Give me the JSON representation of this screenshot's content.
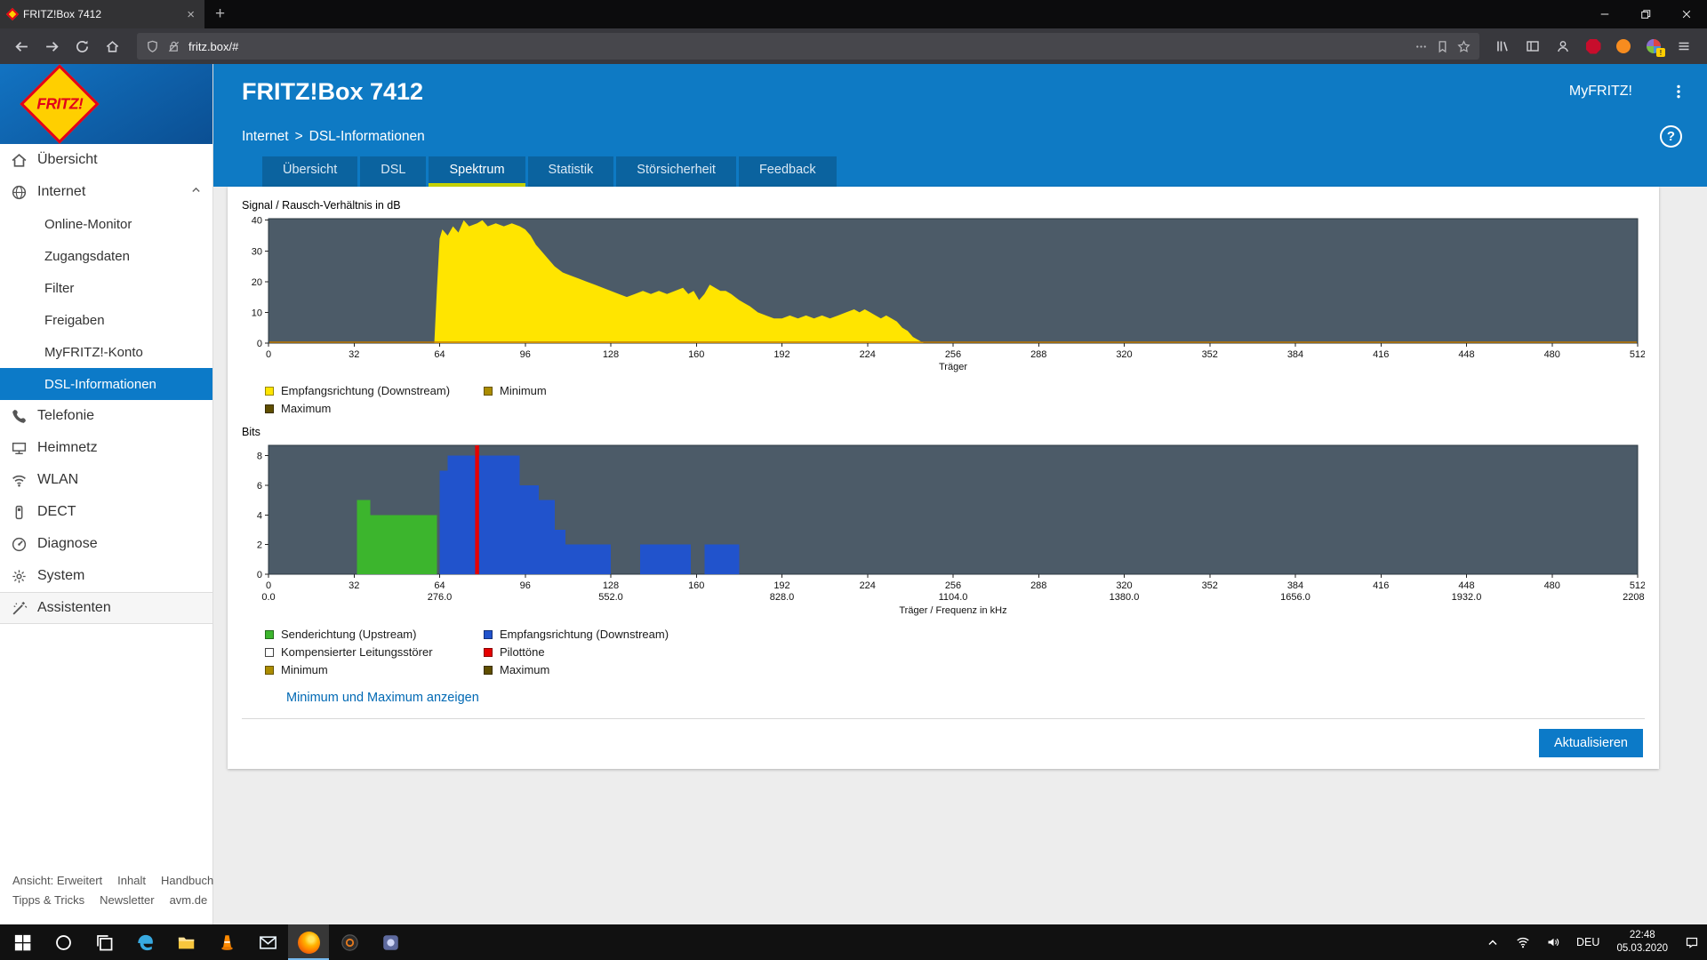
{
  "browser": {
    "tab_title": "FRITZ!Box 7412",
    "close_glyph": "×",
    "new_tab_glyph": "+",
    "url": "fritz.box/#",
    "ext_badge": "!"
  },
  "header": {
    "title": "FRITZ!Box 7412",
    "myfritz_label": "MyFRITZ!",
    "help_glyph": "?"
  },
  "breadcrumb": {
    "section": "Internet",
    "separator": ">",
    "page": "DSL-Informationen"
  },
  "app": {
    "logo_text": "FRITZ!"
  },
  "tabs": [
    {
      "label": "Übersicht",
      "active": false
    },
    {
      "label": "DSL",
      "active": false
    },
    {
      "label": "Spektrum",
      "active": true
    },
    {
      "label": "Statistik",
      "active": false
    },
    {
      "label": "Störsicherheit",
      "active": false
    },
    {
      "label": "Feedback",
      "active": false
    }
  ],
  "sidebar": {
    "items": [
      {
        "label": "Übersicht",
        "icon": "home",
        "level": 0
      },
      {
        "label": "Internet",
        "icon": "globe",
        "level": 0,
        "expanded": true
      },
      {
        "label": "Online-Monitor",
        "level": 1
      },
      {
        "label": "Zugangsdaten",
        "level": 1
      },
      {
        "label": "Filter",
        "level": 1
      },
      {
        "label": "Freigaben",
        "level": 1
      },
      {
        "label": "MyFRITZ!-Konto",
        "level": 1
      },
      {
        "label": "DSL-Informationen",
        "level": 1,
        "selected": true
      },
      {
        "label": "Telefonie",
        "icon": "phone",
        "level": 0
      },
      {
        "label": "Heimnetz",
        "icon": "network",
        "level": 0
      },
      {
        "label": "WLAN",
        "icon": "wifi",
        "level": 0
      },
      {
        "label": "DECT",
        "icon": "dect",
        "level": 0
      },
      {
        "label": "Diagnose",
        "icon": "diagnose",
        "level": 0
      },
      {
        "label": "System",
        "icon": "system",
        "level": 0
      },
      {
        "label": "Assistenten",
        "icon": "assist",
        "level": 0,
        "footer": true
      }
    ]
  },
  "content": {
    "show_minmax_link": "Minimum und Maximum anzeigen",
    "refresh_button": "Aktualisieren"
  },
  "footer_links": {
    "row1": [
      "Ansicht: Erweitert",
      "Inhalt",
      "Handbuch"
    ],
    "row2": [
      "Tipps & Tricks",
      "Newsletter",
      "avm.de"
    ]
  },
  "taskbar": {
    "language": "DEU",
    "time": "22:48",
    "date": "05.03.2020",
    "apps": [
      {
        "name": "start",
        "active": false
      },
      {
        "name": "search",
        "active": false
      },
      {
        "name": "taskview",
        "active": false
      },
      {
        "name": "edge",
        "active": false
      },
      {
        "name": "explorer",
        "active": false
      },
      {
        "name": "vlc",
        "active": false
      },
      {
        "name": "mail",
        "active": false
      },
      {
        "name": "firefox",
        "active": true
      },
      {
        "name": "media-app",
        "active": false
      },
      {
        "name": "photos-app",
        "active": false
      }
    ]
  },
  "chart_data": [
    {
      "type": "area",
      "name": "snr-spectrum-chart",
      "title": "Signal / Rausch-Verhältnis in dB",
      "xlabel": "Träger",
      "xlim": [
        0,
        512
      ],
      "ylim": [
        0,
        40
      ],
      "xticks": [
        0,
        32,
        64,
        96,
        128,
        160,
        192,
        224,
        256,
        288,
        320,
        352,
        384,
        416,
        448,
        480,
        512
      ],
      "yticks": [
        0,
        10,
        20,
        30,
        40
      ],
      "grid": false,
      "plot_bg": "#4c5b68",
      "baseline_color": "#c17a00",
      "series": [
        {
          "name": "Empfangsrichtung (Downstream)",
          "color": "#ffe500",
          "points": [
            [
              0,
              0
            ],
            [
              62,
              0
            ],
            [
              63,
              18
            ],
            [
              64,
              34
            ],
            [
              65,
              37
            ],
            [
              67,
              35
            ],
            [
              69,
              38
            ],
            [
              71,
              36
            ],
            [
              73,
              40
            ],
            [
              75,
              38
            ],
            [
              78,
              39
            ],
            [
              80,
              40
            ],
            [
              82,
              38
            ],
            [
              85,
              39
            ],
            [
              88,
              38
            ],
            [
              91,
              39
            ],
            [
              94,
              38
            ],
            [
              96,
              37
            ],
            [
              98,
              35
            ],
            [
              100,
              32
            ],
            [
              102,
              30
            ],
            [
              104,
              28
            ],
            [
              107,
              25
            ],
            [
              110,
              23
            ],
            [
              113,
              22
            ],
            [
              116,
              21
            ],
            [
              119,
              20
            ],
            [
              122,
              19
            ],
            [
              125,
              18
            ],
            [
              128,
              17
            ],
            [
              131,
              16
            ],
            [
              134,
              15
            ],
            [
              137,
              16
            ],
            [
              140,
              17
            ],
            [
              143,
              16
            ],
            [
              146,
              17
            ],
            [
              149,
              16
            ],
            [
              152,
              17
            ],
            [
              155,
              18
            ],
            [
              157,
              16
            ],
            [
              159,
              17
            ],
            [
              161,
              14
            ],
            [
              163,
              16
            ],
            [
              165,
              19
            ],
            [
              167,
              18
            ],
            [
              169,
              17
            ],
            [
              171,
              17
            ],
            [
              173,
              16
            ],
            [
              176,
              14
            ],
            [
              178,
              13
            ],
            [
              180,
              12
            ],
            [
              183,
              10
            ],
            [
              186,
              9
            ],
            [
              189,
              8
            ],
            [
              192,
              8
            ],
            [
              195,
              9
            ],
            [
              198,
              8
            ],
            [
              201,
              9
            ],
            [
              204,
              8
            ],
            [
              207,
              9
            ],
            [
              210,
              8
            ],
            [
              213,
              9
            ],
            [
              216,
              10
            ],
            [
              219,
              11
            ],
            [
              221,
              10
            ],
            [
              223,
              11
            ],
            [
              225,
              10
            ],
            [
              227,
              9
            ],
            [
              229,
              8
            ],
            [
              231,
              9
            ],
            [
              233,
              8
            ],
            [
              235,
              7
            ],
            [
              237,
              5
            ],
            [
              239,
              4
            ],
            [
              241,
              2
            ],
            [
              243,
              1
            ],
            [
              245,
              0
            ],
            [
              512,
              0
            ]
          ]
        }
      ],
      "legend": [
        {
          "label": "Empfangsrichtung (Downstream)",
          "color": "#ffe500"
        },
        {
          "label": "Minimum",
          "color": "#ab8c00"
        },
        {
          "label": "Maximum",
          "color": "#5f4e00"
        }
      ]
    },
    {
      "type": "bar",
      "name": "bits-allocation-chart",
      "title": "Bits",
      "xlabel": "Träger / Frequenz in kHz",
      "xlim": [
        0,
        512
      ],
      "ylim": [
        0,
        8
      ],
      "xticks": [
        0,
        32,
        64,
        96,
        128,
        160,
        192,
        224,
        256,
        288,
        320,
        352,
        384,
        416,
        448,
        480,
        512
      ],
      "xticks_freq": [
        "0.0",
        "276.0",
        "552.0",
        "828.0",
        "1104.0",
        "1380.0",
        "1656.0",
        "1932.0",
        "2208.0"
      ],
      "yticks": [
        0,
        2,
        4,
        6,
        8
      ],
      "grid": false,
      "plot_bg": "#4c5b68",
      "series_colors": {
        "upstream": "#3cb52d",
        "downstream": "#2153cc"
      },
      "pilot_color": "#e60000",
      "segments": [
        {
          "from": 33,
          "to": 38,
          "bits": 5,
          "series": "upstream"
        },
        {
          "from": 38,
          "to": 63,
          "bits": 4,
          "series": "upstream"
        },
        {
          "from": 64,
          "to": 67,
          "bits": 7,
          "series": "downstream"
        },
        {
          "from": 67,
          "to": 94,
          "bits": 8,
          "series": "downstream"
        },
        {
          "from": 94,
          "to": 101,
          "bits": 6,
          "series": "downstream"
        },
        {
          "from": 101,
          "to": 107,
          "bits": 5,
          "series": "downstream"
        },
        {
          "from": 107,
          "to": 111,
          "bits": 3,
          "series": "downstream"
        },
        {
          "from": 111,
          "to": 128,
          "bits": 2,
          "series": "downstream"
        },
        {
          "from": 139,
          "to": 158,
          "bits": 2,
          "series": "downstream"
        },
        {
          "from": 163,
          "to": 176,
          "bits": 2,
          "series": "downstream"
        }
      ],
      "pilots": [
        78
      ],
      "legend": [
        {
          "label": "Senderichtung (Upstream)",
          "color": "#3cb52d"
        },
        {
          "label": "Empfangsrichtung (Downstream)",
          "color": "#2153cc"
        },
        {
          "label": "Kompensierter Leitungsstörer",
          "color": "#ffffff",
          "outline": true
        },
        {
          "label": "Pilottöne",
          "color": "#e60000"
        },
        {
          "label": "Minimum",
          "color": "#ab8c00"
        },
        {
          "label": "Maximum",
          "color": "#5f4e00"
        }
      ]
    }
  ]
}
